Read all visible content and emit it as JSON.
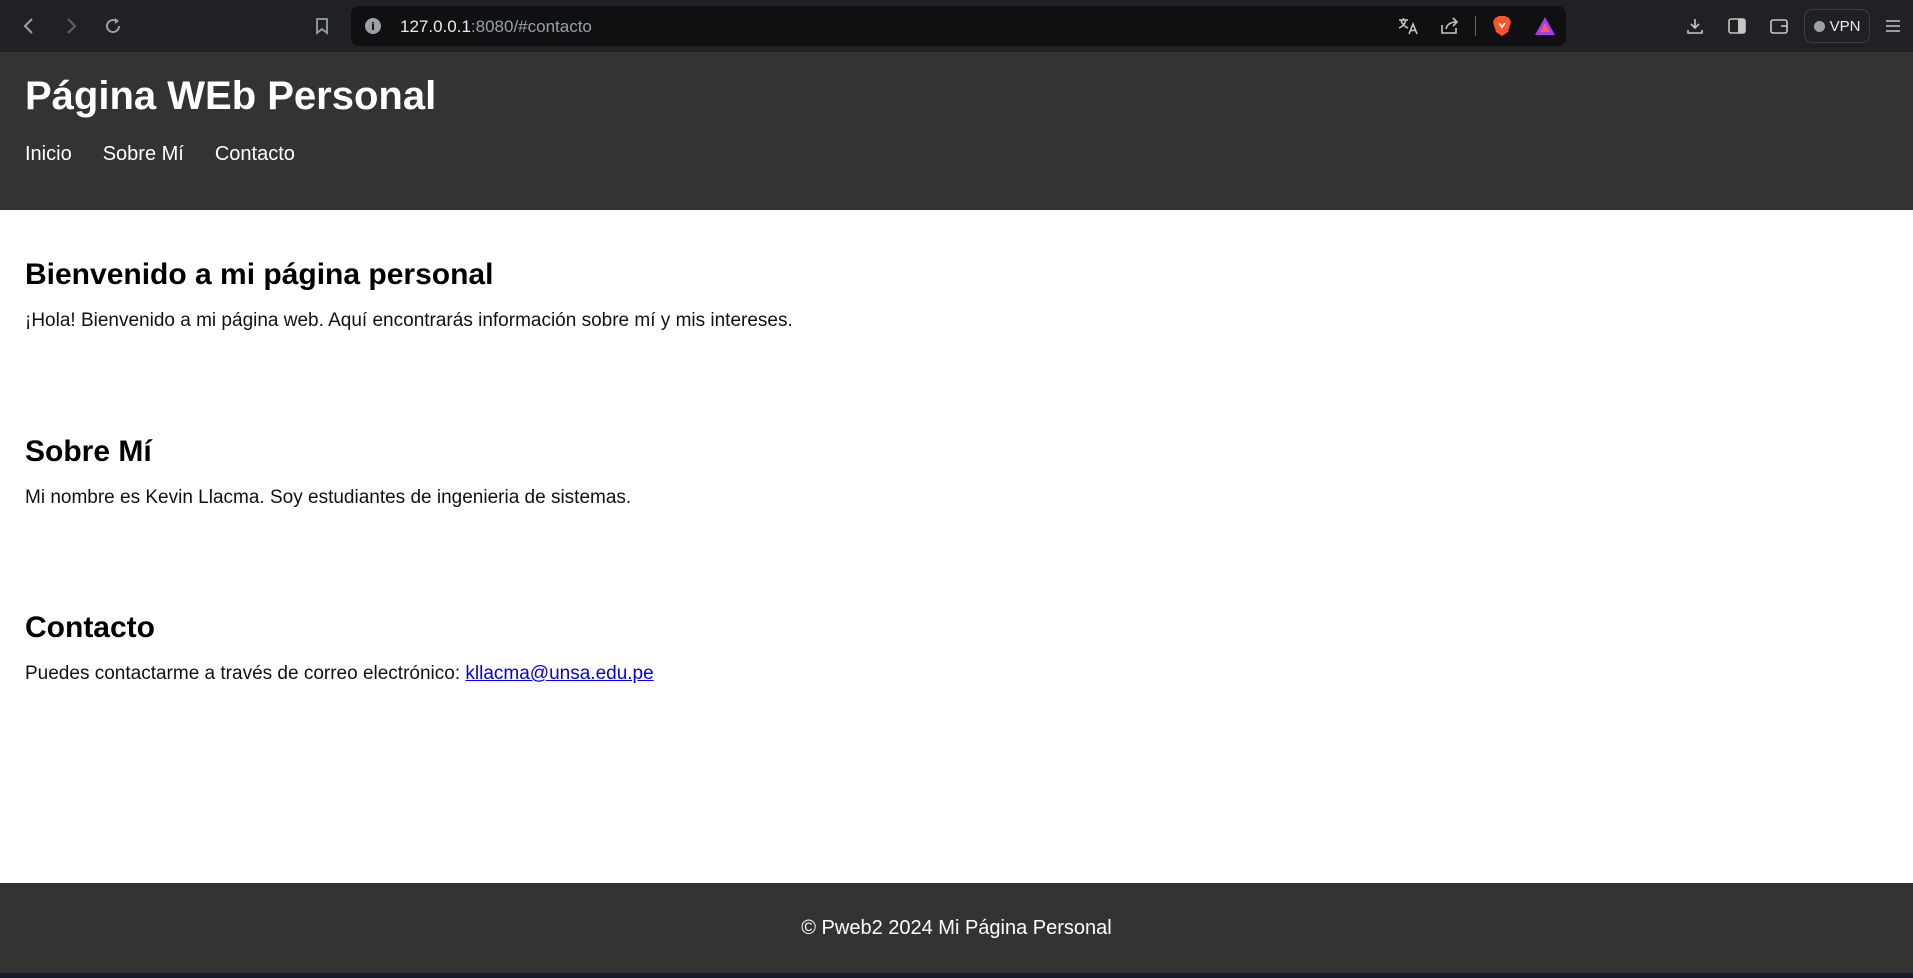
{
  "browser": {
    "url_host": "127.0.0.1",
    "url_rest": ":8080/#contacto",
    "vpn_label": "VPN",
    "icons": {
      "back": "back-arrow-icon",
      "forward": "forward-arrow-icon",
      "reload": "reload-icon",
      "bookmark": "bookmark-icon",
      "info": "info-icon",
      "translate": "translate-icon",
      "share": "share-icon",
      "brave_shield": "brave-shield-icon",
      "rewards": "rewards-triangle-icon",
      "download": "download-icon",
      "sidebar": "sidebar-icon",
      "wallet": "wallet-icon",
      "menu": "hamburger-menu-icon"
    },
    "colors": {
      "brave_orange": "#fb542b",
      "rewards_purple": "#a43fe8"
    }
  },
  "header": {
    "title": "Página WEb Personal",
    "nav": [
      {
        "label": "Inicio"
      },
      {
        "label": "Sobre Mí"
      },
      {
        "label": "Contacto"
      }
    ],
    "background": "#333333"
  },
  "sections": {
    "inicio": {
      "heading": "Bienvenido a mi página personal",
      "text": "¡Hola! Bienvenido a mi página web. Aquí encontrarás información sobre mí y mis intereses."
    },
    "sobre_mi": {
      "heading": "Sobre Mí",
      "text": "Mi nombre es Kevin Llacma. Soy estudiantes de ingenieria de sistemas."
    },
    "contacto": {
      "heading": "Contacto",
      "text": "Puedes contactarme a través de correo electrónico: ",
      "email": "kllacma@unsa.edu.pe"
    }
  },
  "footer": {
    "text": "© Pweb2 2024 Mi Página Personal"
  }
}
